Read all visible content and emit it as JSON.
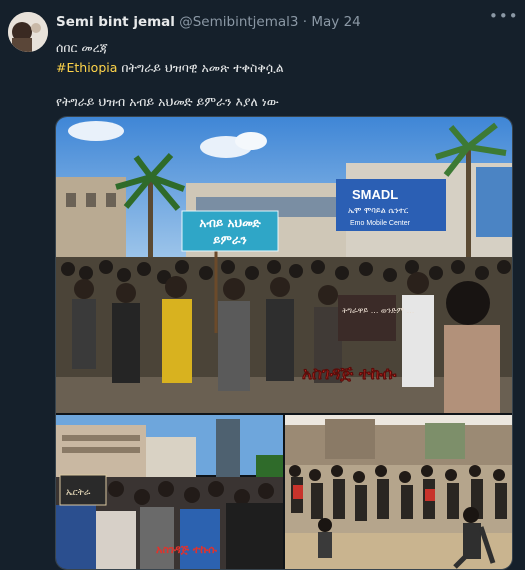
{
  "tweet": {
    "author_name": "Semi bint jemal",
    "handle": "@Semibintjemal3",
    "separator": "·",
    "date": "May 24",
    "more_icon": "more-dots-icon",
    "line1": "ሰበር መረጃ",
    "hashtag": "#Ethiopia",
    "line2_rest": " በትግራይ ህዝባዊ አመጽ ተቀስቅሷል",
    "line3": "የትግራይ ህዝብ አብይ አህመድ ይምራን እያለ ነው"
  },
  "media": {
    "photo1": {
      "banner_line1": "አብይ አህመድ",
      "banner_line2": "ይምራን",
      "store_brand": "SMADL",
      "store_line2": "ኤሞ ሞባይል ሴንተር",
      "store_line3": "Emo Mobile Center",
      "sign_text": "ትግራዋይ ... ወንድም ...",
      "overlay_text": "አስገዳጅ ተኩሱ"
    },
    "photo2": {
      "sign_text": "ኤርትራ",
      "overlay_text": "አስገዳጅ ተኩሱ"
    },
    "photo3": {}
  }
}
